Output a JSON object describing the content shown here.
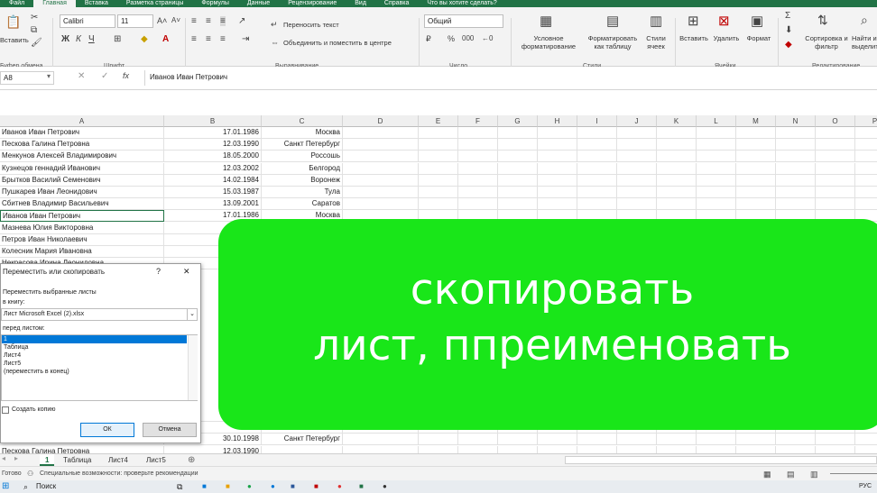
{
  "ribbon_tabs": [
    "Файл",
    "Главная",
    "Вставка",
    "Разметка страницы",
    "Формулы",
    "Данные",
    "Рецензирование",
    "Вид",
    "Справка",
    "Что вы хотите сделать?"
  ],
  "ribbon": {
    "font_name": "Calibri",
    "font_size": "11",
    "wrap_text": "Переносить текст",
    "merge_center": "Объединить и поместить в центре",
    "number_format": "Общий",
    "cond_format": "Условное форматирование",
    "format_table": "Форматировать как таблицу",
    "cell_styles": "Стили ячеек",
    "insert": "Вставить",
    "delete": "Удалить",
    "format": "Формат",
    "sort_filter": "Сортировка и фильтр",
    "find": "Найти и выделить",
    "paste": "Вставить",
    "bold": "Ж",
    "italic": "К",
    "underline": "Ч",
    "groups": {
      "clipboard": "Буфер обмена",
      "font": "Шрифт",
      "alignment": "Выравнивание",
      "number": "Число",
      "styles": "Стили",
      "cells": "Ячейки",
      "editing": "Редактирование"
    }
  },
  "formula_bar": {
    "name_box": "A8",
    "fx": "fx",
    "content": "Иванов Иван Петрович"
  },
  "columns": [
    "A",
    "B",
    "C",
    "D",
    "E",
    "F",
    "G",
    "H",
    "I",
    "J",
    "K",
    "L",
    "M",
    "N",
    "O",
    "P"
  ],
  "rows": [
    {
      "name": "Иванов Иван Петрович",
      "date": "17.01.1986",
      "city": "Москва"
    },
    {
      "name": "Пескова Галина Петровна",
      "date": "12.03.1990",
      "city": "Санкт Петербург"
    },
    {
      "name": "Менкунов Алексей Владимирович",
      "date": "18.05.2000",
      "city": "Россошь"
    },
    {
      "name": "Кузнецов геннадий Иванович",
      "date": "12.03.2002",
      "city": "Белгород"
    },
    {
      "name": "Брыткoв Василий Семенович",
      "date": "14.02.1984",
      "city": "Воронеж"
    },
    {
      "name": "Пушкарев Иван Леонидович",
      "date": "15.03.1987",
      "city": "Тула"
    },
    {
      "name": "Сбитнев Владимир Васильевич",
      "date": "13.09.2001",
      "city": "Саратов"
    },
    {
      "name": "Иванов Иван Петрович",
      "date": "17.01.1986",
      "city": "Москва"
    },
    {
      "name": "Мазнева Юлия Викторовна",
      "date": "17",
      "city": ""
    },
    {
      "name": "Петров Иван Николаевич",
      "date": "",
      "city": ""
    },
    {
      "name": "Колесник Мария Ивановна",
      "date": "",
      "city": ""
    },
    {
      "name": "Некрасова Ирина Леонидовна",
      "date": "",
      "city": ""
    }
  ],
  "bottom_rows": [
    {
      "name": "",
      "date": "1",
      "city": ""
    },
    {
      "name": "",
      "date": "24.0",
      "city": ""
    },
    {
      "name": "Ященко Борис Константинович",
      "date": "30.10.1998",
      "city": "Санкт Петербург"
    },
    {
      "name": "Пескова Галина Петровна",
      "date": "12.03.1990",
      "city": ""
    }
  ],
  "overlay": {
    "line1": "скопировать",
    "line2": "лист, ппреименовать"
  },
  "dialog": {
    "title": "Переместить или скопировать",
    "help": "?",
    "close": "✕",
    "move_label": "Переместить выбранные листы",
    "to_book": "в книгу:",
    "book": "Лист Microsoft Excel (2).xlsx",
    "before_label": "перед листом:",
    "sheets": [
      "1",
      "Таблица",
      "Лист4",
      "Лист5",
      "(переместить в конец)"
    ],
    "copy": "Создать копию",
    "ok": "ОК",
    "cancel": "Отмена"
  },
  "sheet_tabs": [
    "1",
    "Таблица",
    "Лист4",
    "Лист5"
  ],
  "status": {
    "mode": "Готово",
    "accessibility": "Специальные возможности: проверьте рекомендации"
  },
  "taskbar": {
    "search": "Поиск",
    "lang": "РУС"
  },
  "colors": {
    "accent": "#217346",
    "overlay": "#19e619",
    "selection": "#0078d7"
  }
}
